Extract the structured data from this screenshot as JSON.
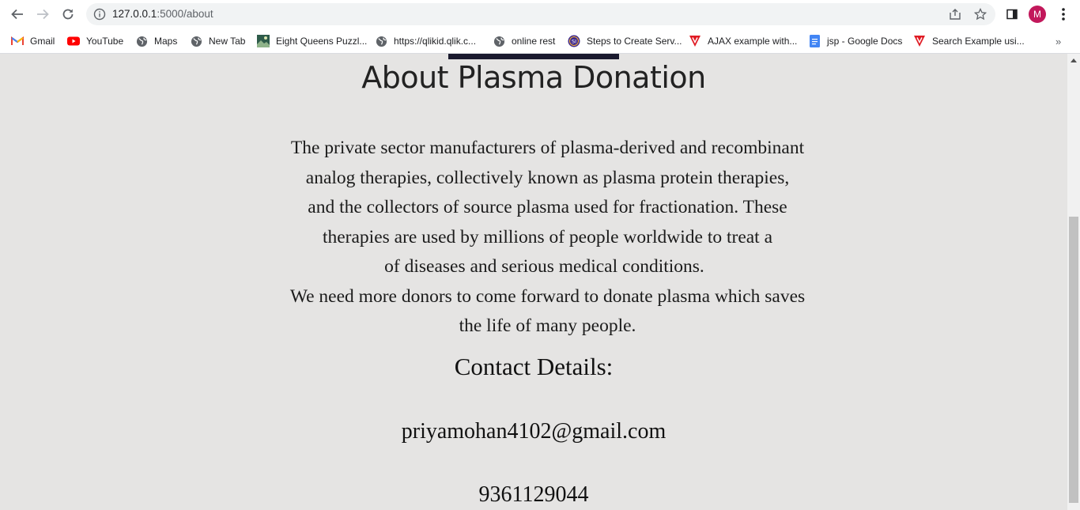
{
  "browser": {
    "url_host": "127.0.0.1",
    "url_path": ":5000/about",
    "profile_initial": "M",
    "colors": {
      "accent_avatar": "#c2185b",
      "page_background": "#e5e4e3"
    }
  },
  "bookmarks": [
    {
      "label": "Gmail",
      "icon": "gmail-icon"
    },
    {
      "label": "YouTube",
      "icon": "youtube-icon"
    },
    {
      "label": "Maps",
      "icon": "globe-icon"
    },
    {
      "label": "New Tab",
      "icon": "globe-icon"
    },
    {
      "label": "Eight Queens Puzzl...",
      "icon": "image-icon"
    },
    {
      "label": "https://qlikid.qlik.c...",
      "icon": "globe-icon"
    },
    {
      "label": "online rest",
      "icon": "globe-icon"
    },
    {
      "label": "Steps to Create Serv...",
      "icon": "si-icon"
    },
    {
      "label": "AJAX example with...",
      "icon": "v-logo-icon"
    },
    {
      "label": "jsp - Google Docs",
      "icon": "docs-icon"
    },
    {
      "label": "Search Example usi...",
      "icon": "v-logo-icon"
    }
  ],
  "page": {
    "title": "About Plasma Donation",
    "paragraph_lines": [
      "The private sector manufacturers of plasma-derived and recombinant",
      "analog therapies, collectively known as plasma protein therapies,",
      "and the collectors of source plasma used for fractionation. These",
      "therapies are used by millions of people worldwide to treat a",
      "of diseases and serious medical conditions.",
      "We need more donors to come forward to donate plasma which saves",
      "the life of many people."
    ],
    "contact_heading": "Contact Details:",
    "email": "priyamohan4102@gmail.com",
    "phone": "9361129044"
  }
}
